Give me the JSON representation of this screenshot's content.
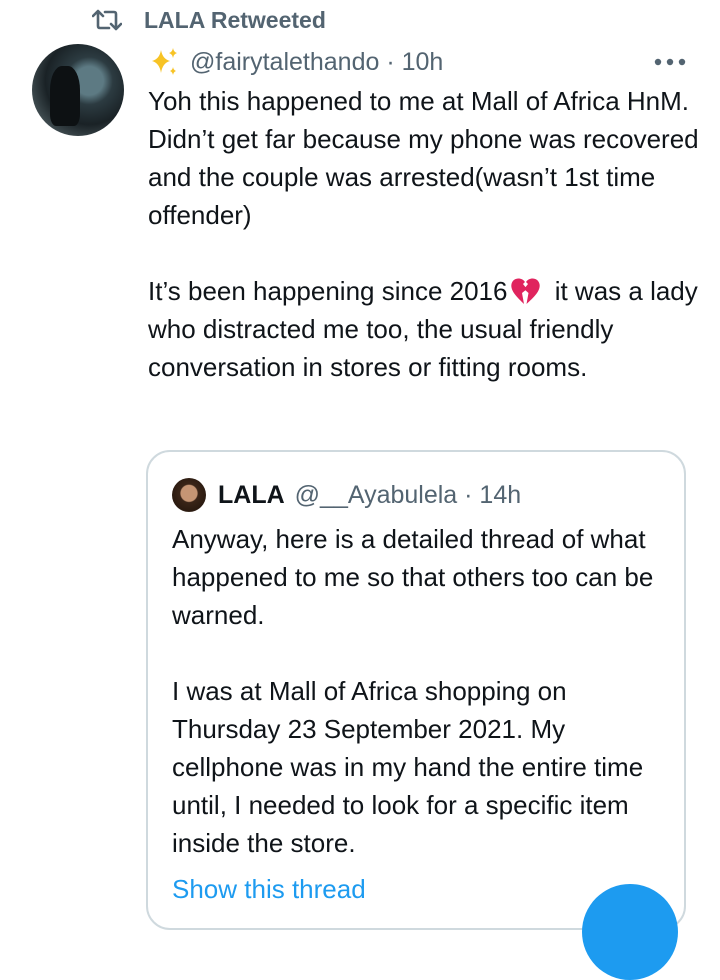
{
  "retweet": {
    "label": "LALA Retweeted",
    "icon": "retweet-icon"
  },
  "tweet": {
    "avatar": "avatar",
    "sparkle_icon": "sparkle-icon",
    "handle_time": "@fairytalethando · 10h",
    "more_icon": "more-icon",
    "para1": "Yoh this happened to me at Mall of Africa HnM. Didn’t get far because my phone was recovered and the couple was arrested(wasn’t 1st time offender)",
    "para2_before": "It’s been happening since 2016",
    "emoji_icon": "broken-heart-icon",
    "para2_after": " it was a lady who distracted me too, the usual friendly conversation in stores or fitting rooms."
  },
  "quote": {
    "name": "LALA",
    "handle_time": "@__Ayabulela · 14h",
    "para1": "Anyway, here is a detailed thread of what happened to me so that others too can be warned.",
    "para2": "I was at Mall of Africa shopping on Thursday 23 September 2021. My cellphone was in my hand the entire time until, I needed to look for a specific item inside the store.",
    "show_thread": "Show this thread"
  },
  "colors": {
    "text": "#0f1419",
    "secondary": "#536471",
    "accent": "#1d9bf0",
    "border": "#cfd9de"
  }
}
